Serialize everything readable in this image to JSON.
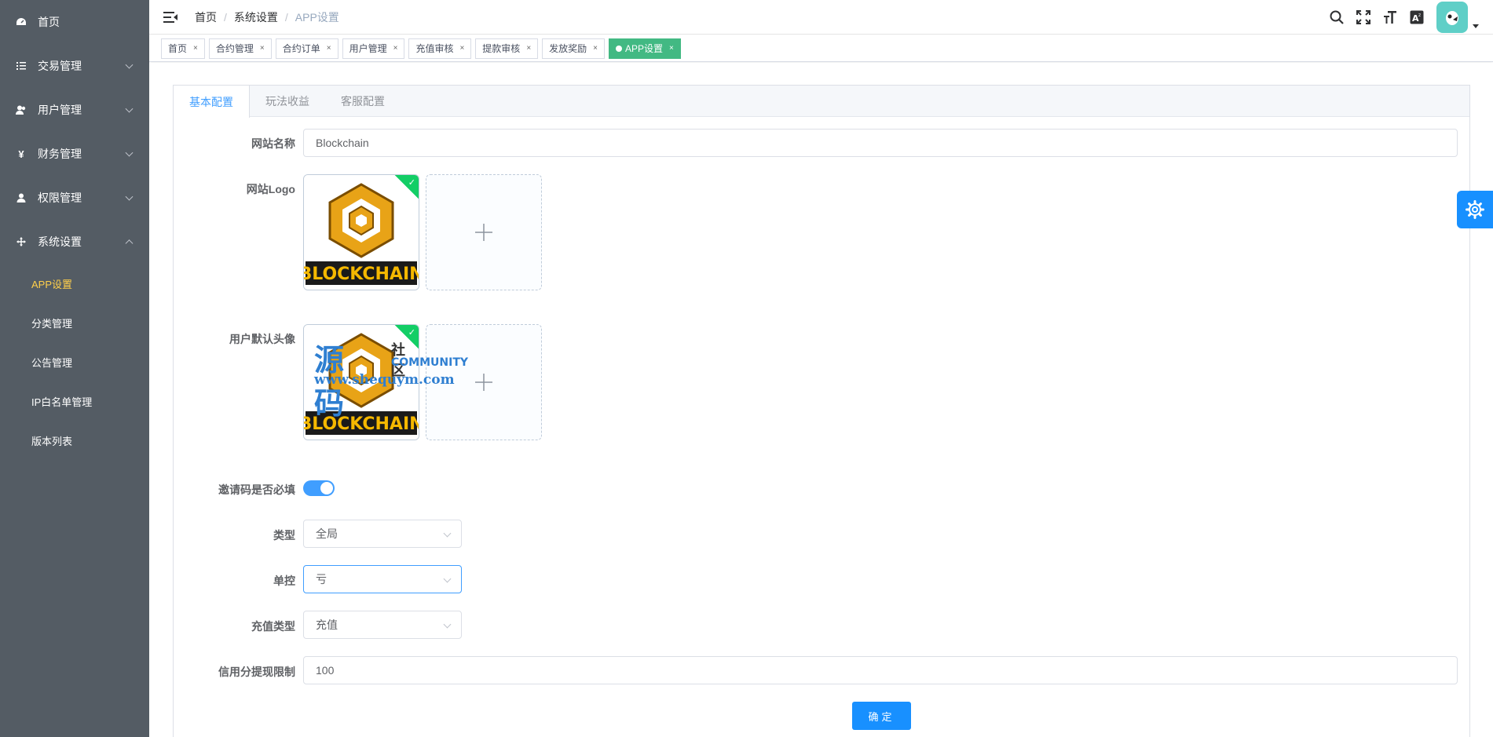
{
  "sidebar": {
    "items": [
      {
        "label": "首页",
        "icon": "dashboard-icon",
        "has_arrow": false
      },
      {
        "label": "交易管理",
        "icon": "list-icon",
        "has_arrow": true
      },
      {
        "label": "用户管理",
        "icon": "users-icon",
        "has_arrow": true
      },
      {
        "label": "财务管理",
        "icon": "yen-icon",
        "has_arrow": true
      },
      {
        "label": "权限管理",
        "icon": "user-icon",
        "has_arrow": true
      },
      {
        "label": "系统设置",
        "icon": "move-icon",
        "has_arrow": true,
        "expanded": true
      }
    ],
    "sub_items": [
      {
        "label": "APP设置",
        "active": true
      },
      {
        "label": "分类管理",
        "active": false
      },
      {
        "label": "公告管理",
        "active": false
      },
      {
        "label": "IP白名单管理",
        "active": false
      },
      {
        "label": "版本列表",
        "active": false
      }
    ],
    "active_color": "#ffd04b",
    "bg_color": "#545c64"
  },
  "header": {
    "breadcrumb": [
      "首页",
      "系统设置",
      "APP设置"
    ],
    "breadcrumb_separator": "/",
    "icons": [
      "search-icon",
      "fullscreen-icon",
      "font-size-icon",
      "language-icon"
    ]
  },
  "tags": [
    {
      "label": "首页",
      "active": false
    },
    {
      "label": "合约管理",
      "active": false
    },
    {
      "label": "合约订单",
      "active": false
    },
    {
      "label": "用户管理",
      "active": false
    },
    {
      "label": "充值审核",
      "active": false
    },
    {
      "label": "提款审核",
      "active": false
    },
    {
      "label": "发放奖励",
      "active": false
    },
    {
      "label": "APP设置",
      "active": true
    }
  ],
  "tag_close": "×",
  "tabs": [
    {
      "label": "基本配置",
      "active": true
    },
    {
      "label": "玩法收益",
      "active": false
    },
    {
      "label": "客服配置",
      "active": false
    }
  ],
  "form": {
    "site_name": {
      "label": "网站名称",
      "value": "Blockchain"
    },
    "site_logo": {
      "label": "网站Logo",
      "image_text": "BLOCKCHAIN"
    },
    "default_avatar": {
      "label": "用户默认头像",
      "image_text": "BLOCKCHAIN"
    },
    "invite_required": {
      "label": "邀请码是否必填",
      "on": true
    },
    "type": {
      "label": "类型",
      "value": "全局"
    },
    "single_control": {
      "label": "单控",
      "value": "亏"
    },
    "recharge_type": {
      "label": "充值类型",
      "value": "充值"
    },
    "credit_limit": {
      "label": "信用分提现限制",
      "value": "100"
    },
    "submit_label": "确定"
  },
  "watermark": {
    "big": "源码",
    "small": "社区",
    "community": "COMMUNITY",
    "url": "www.shequym.com"
  },
  "colors": {
    "primary": "#409eff",
    "button": "#1890ff",
    "tag_active": "#42b983",
    "success": "#13ce66",
    "logo_gold": "#e8a317"
  }
}
